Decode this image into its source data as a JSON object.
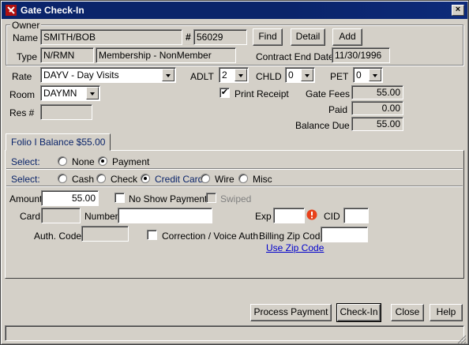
{
  "window": {
    "title": "Gate Check-In",
    "close_glyph": "×"
  },
  "owner": {
    "legend": "Owner",
    "name_label": "Name",
    "name_value": "SMITH/BOB",
    "hash_label": "#",
    "number_value": "56029",
    "find_label": "Find",
    "detail_label": "Detail",
    "add_label": "Add",
    "type_label": "Type",
    "type_code": "N/RMN",
    "type_desc": "Membership - NonMember",
    "contract_label": "Contract End Date",
    "contract_value": "11/30/1996"
  },
  "rate": {
    "rate_label": "Rate",
    "rate_value": "DAYV - Day Visits",
    "adlt_label": "ADLT",
    "adlt_value": "2",
    "chld_label": "CHLD",
    "chld_value": "0",
    "pet_label": "PET",
    "pet_value": "0",
    "room_label": "Room",
    "room_value": "DAYMN",
    "print_receipt_label": "Print Receipt",
    "print_receipt_checked": true,
    "res_label": "Res #",
    "res_value": "",
    "gate_fees_label": "Gate Fees",
    "gate_fees_value": "55.00",
    "paid_label": "Paid",
    "paid_value": "0.00",
    "balance_due_label": "Balance Due",
    "balance_due_value": "55.00"
  },
  "folio": {
    "tab_label": "Folio I Balance $55.00",
    "select1_label": "Select:",
    "opt_none": "None",
    "opt_payment": "Payment",
    "select2_label": "Select:",
    "opt_cash": "Cash",
    "opt_check": "Check",
    "opt_credit": "Credit Card",
    "opt_wire": "Wire",
    "opt_misc": "Misc",
    "amount_label": "Amount",
    "amount_value": "55.00",
    "no_show_label": "No Show Payment",
    "swiped_label": "Swiped",
    "card_label": "Card",
    "number_label": "Number",
    "exp_label": "Exp",
    "cid_label": "CID",
    "auth_label": "Auth. Code",
    "correction_label": "Correction / Voice Auth",
    "billing_zip_label": "Billing Zip Code",
    "use_zip_label": "Use Zip Code"
  },
  "footer": {
    "process_label": "Process Payment",
    "checkin_label": "Check-In",
    "close_label": "Close",
    "help_label": "Help"
  },
  "colors": {
    "titlebar": "#0a246a",
    "face": "#d4d0c8",
    "link": "#0000cc",
    "warning": "#e8401a"
  }
}
